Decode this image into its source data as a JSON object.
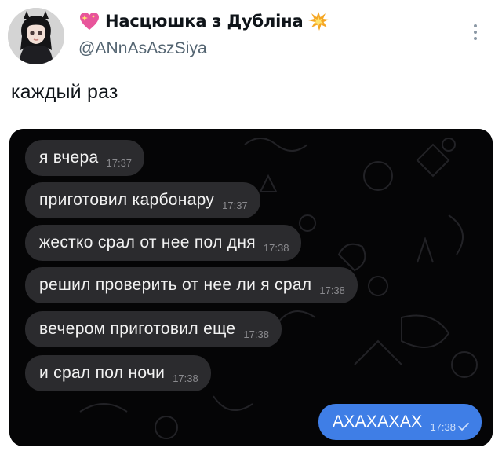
{
  "author": {
    "display_name": "Насцюшка з Дубліна",
    "handle": "@ANnAsAszSiya",
    "name_prefix_icon": "sparkling-heart-icon",
    "name_suffix_icon": "collision-icon"
  },
  "tweet": {
    "text": "каждый раз"
  },
  "chat": {
    "incoming": [
      {
        "text": "я вчера",
        "time": "17:37"
      },
      {
        "text": "приготовил карбонару",
        "time": "17:37"
      },
      {
        "text": "жестко срал от нее пол дня",
        "time": "17:38"
      },
      {
        "text": "решил проверить от нее ли я срал",
        "time": "17:38"
      },
      {
        "text": "вечером приготовил еще",
        "time": "17:38"
      },
      {
        "text": "и срал пол ночи",
        "time": "17:38"
      }
    ],
    "outgoing": {
      "text": "АХАХАХАХ",
      "time": "17:38",
      "status_icon": "check-icon"
    },
    "colors": {
      "incoming_bubble": "#2b2b2e",
      "outgoing_bubble": "#3f7ee6",
      "background": "#050506"
    }
  }
}
